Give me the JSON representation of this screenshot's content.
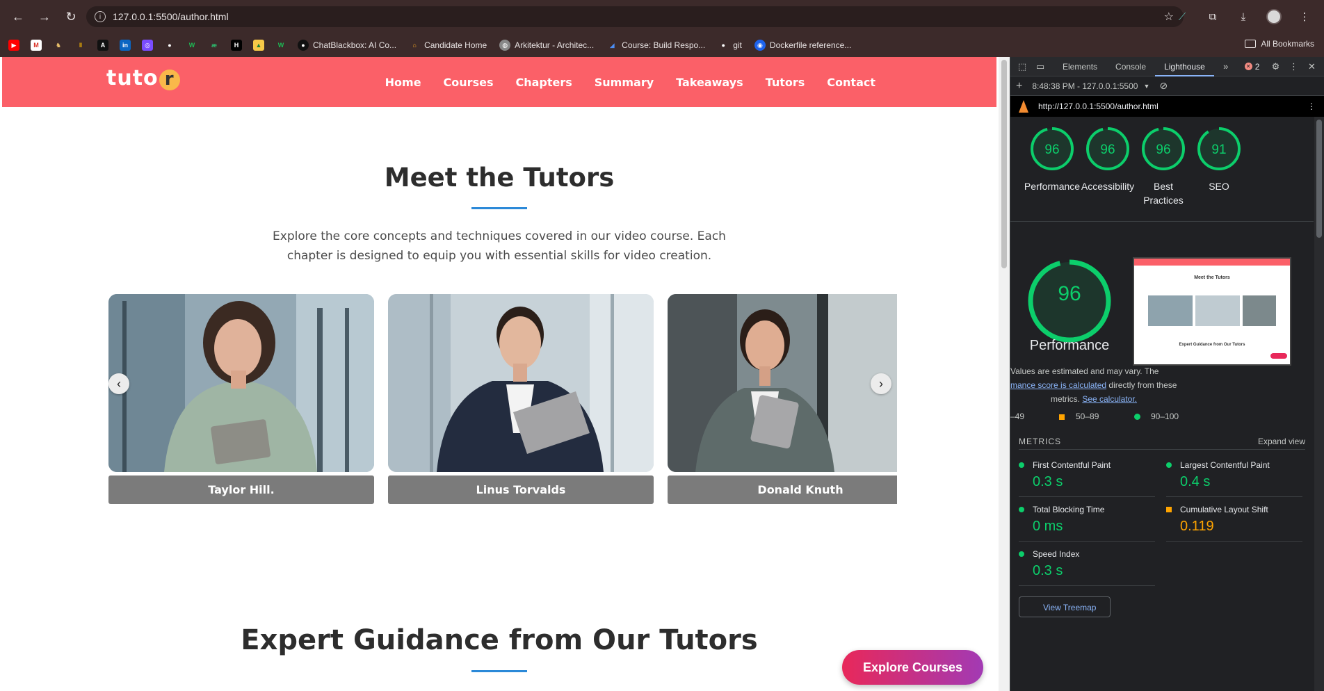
{
  "browser": {
    "url": "127.0.0.1:5500/author.html",
    "bookmarks": [
      {
        "label": "ChatBlackbox: AI Co...",
        "icon": "blackbox-icon"
      },
      {
        "label": "Candidate Home",
        "icon": "candidate-icon"
      },
      {
        "label": "Arkitektur - Architec...",
        "icon": "globe-icon"
      },
      {
        "label": "Course: Build Respo...",
        "icon": "course-icon"
      },
      {
        "label": "git",
        "icon": "github-icon"
      },
      {
        "label": "Dockerfile reference...",
        "icon": "docker-icon"
      }
    ],
    "all_bookmarks": "All Bookmarks"
  },
  "site": {
    "logo_text": "tuto",
    "logo_badge": "r",
    "nav": [
      "Home",
      "Courses",
      "Chapters",
      "Summary",
      "Takeaways",
      "Tutors",
      "Contact"
    ],
    "section_title": "Meet the Tutors",
    "section_desc": "Explore the core concepts and techniques covered in our video course. Each chapter is designed to equip you with essential skills for video creation.",
    "tutors": [
      "Taylor Hill.",
      "Linus Torvalds",
      "Donald Knuth"
    ],
    "second_title": "Expert Guidance from Our Tutors",
    "cta": "Explore Courses",
    "prev_arrow": "‹",
    "next_arrow": "›"
  },
  "devtools": {
    "tabs": [
      "Elements",
      "Console",
      "Lighthouse"
    ],
    "active_tab": "Lighthouse",
    "error_count": "2",
    "report_time": "8:48:38 PM - 127.0.0.1:5500",
    "report_url": "http://127.0.0.1:5500/author.html",
    "scores": [
      {
        "label": "Performance",
        "value": "96"
      },
      {
        "label": "Accessibility",
        "value": "96"
      },
      {
        "label": "Best\nPractices",
        "value": "96"
      },
      {
        "label": "SEO",
        "value": "91"
      }
    ],
    "perf_big": {
      "value": "96",
      "label": "Performance"
    },
    "estimate_line1": "Values are estimated and may vary. The",
    "estimate_link1": "mance score is calculated",
    "estimate_line2": "directly from these",
    "estimate_line3": "metrics.",
    "estimate_link2": "See calculator.",
    "legend": [
      "–49",
      "50–89",
      "90–100"
    ],
    "metrics_header": "METRICS",
    "expand_view": "Expand view",
    "metrics": [
      {
        "name": "First Contentful Paint",
        "value": "0.3 s",
        "status": "good"
      },
      {
        "name": "Largest Contentful Paint",
        "value": "0.4 s",
        "status": "good"
      },
      {
        "name": "Total Blocking Time",
        "value": "0 ms",
        "status": "good"
      },
      {
        "name": "Cumulative Layout Shift",
        "value": "0.119",
        "status": "average"
      },
      {
        "name": "Speed Index",
        "value": "0.3 s",
        "status": "good"
      }
    ],
    "treemap_btn": "View Treemap",
    "colors": {
      "good": "#0cce6b",
      "average": "#ffa400",
      "poor": "#ff4e42"
    }
  },
  "thumbnail": {
    "title": "Meet the Tutors",
    "footer_title": "Expert Guidance from Our Tutors"
  }
}
